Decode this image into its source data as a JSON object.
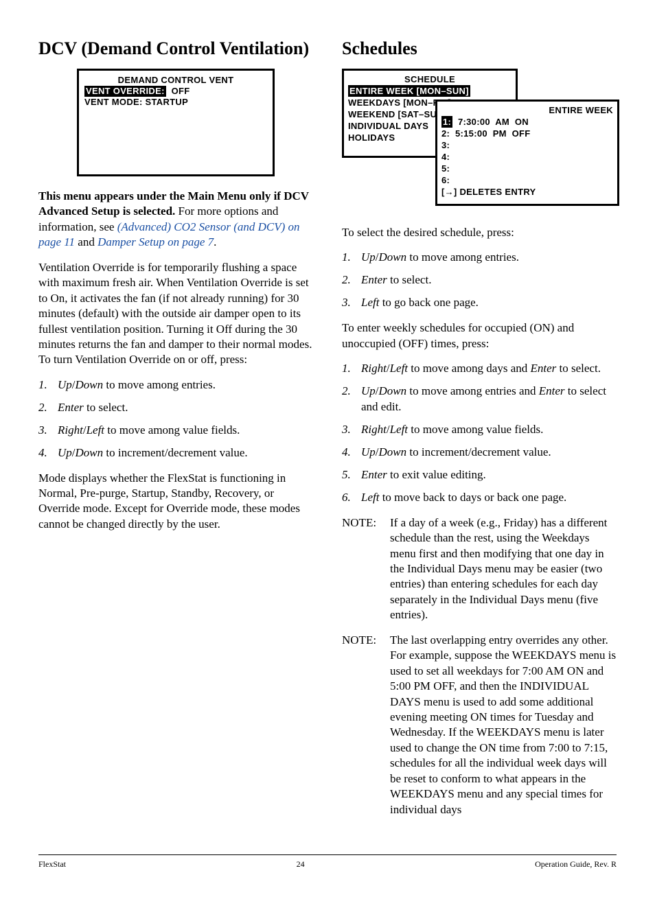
{
  "left": {
    "heading": "DCV (Demand Control Ventilation)",
    "lcd": {
      "title": "DEMAND CONTROL VENT",
      "line1_label": "VENT OVERRIDE:",
      "line1_value": "OFF",
      "line2": "VENT MODE: STARTUP"
    },
    "intro_bold": "This menu appears under the Main Menu only if DCV Advanced Setup is selected.",
    "intro_rest1": " For more options and information, see ",
    "intro_link1": "(Advanced) CO2 Sensor (and DCV) on page 11",
    "intro_rest2": " and ",
    "intro_link2": "Damper Setup on page 7",
    "intro_rest3": ".",
    "para2": "Ventilation Override is for temporarily flushing a space with maximum fresh air. When Ventilation Override is set to On, it activates the fan (if not already running) for 30 minutes (default) with the outside air damper open to its fullest ventilation position. Turning it Off during the 30 minutes returns the fan and damper to their normal modes. To turn Ventilation Override on or off, press:",
    "list1": [
      {
        "n": "1.",
        "it": "Up",
        "sep": "/",
        "it2": "Down",
        "rest": " to move among entries."
      },
      {
        "n": "2.",
        "it": "Enter",
        "rest": " to select."
      },
      {
        "n": "3.",
        "it": "Right",
        "sep": "/",
        "it2": "Left",
        "rest": " to move among value fields."
      },
      {
        "n": "4.",
        "it": "Up",
        "sep": "/",
        "it2": "Down",
        "rest": " to increment/decrement value."
      }
    ],
    "para3": "Mode displays whether the FlexStat is functioning in Normal, Pre-purge, Startup, Standby, Recovery, or Override mode. Except for Override mode, these modes cannot be changed directly by the user."
  },
  "right": {
    "heading": "Schedules",
    "lcd_back": {
      "title": "SCHEDULE",
      "line1": "ENTIRE WEEK [MON–SUN]",
      "line2": "WEEKDAYS [MON–FRI]",
      "line3": "WEEKEND [SAT–SUN]",
      "line4": "INDIVIDUAL DAYS",
      "line5": "HOLIDAYS"
    },
    "lcd_front": {
      "title": "ENTIRE WEEK",
      "rows": [
        {
          "n": "1:",
          "rest": "  7:30:00  AM  ON",
          "sel": true
        },
        {
          "n": "2:",
          "rest": "  5:15:00  PM  OFF"
        },
        {
          "n": "3:",
          "rest": ""
        },
        {
          "n": "4:",
          "rest": ""
        },
        {
          "n": "5:",
          "rest": ""
        },
        {
          "n": "6:",
          "rest": ""
        }
      ],
      "footer": "[→] DELETES ENTRY"
    },
    "para1": "To select the desired schedule, press:",
    "list1": [
      {
        "n": "1.",
        "it": "Up",
        "sep": "/",
        "it2": "Down",
        "rest": " to move among entries."
      },
      {
        "n": "2.",
        "it": "Enter",
        "rest": " to select."
      },
      {
        "n": "3.",
        "it": "Left",
        "rest": " to go back one page."
      }
    ],
    "para2": "To enter weekly schedules for occupied (ON) and unoccupied (OFF) times, press:",
    "list2": [
      {
        "n": "1.",
        "it": "Right",
        "sep": "/",
        "it2": "Left",
        "rest": " to move among days and ",
        "it3": "Enter",
        "rest2": " to select."
      },
      {
        "n": "2.",
        "it": "Up",
        "sep": "/",
        "it2": "Down",
        "rest": " to move among entries and ",
        "it3": "Enter",
        "rest2": " to select and edit."
      },
      {
        "n": "3.",
        "it": "Right",
        "sep": "/",
        "it2": "Left",
        "rest": " to move among value fields."
      },
      {
        "n": "4.",
        "it": "Up",
        "sep": "/",
        "it2": "Down",
        "rest": " to increment/decrement value."
      },
      {
        "n": "5.",
        "it": "Enter",
        "rest": " to exit value editing."
      },
      {
        "n": "6.",
        "it": "Left",
        "rest": " to move back to days or back one page."
      }
    ],
    "note1_label": "NOTE:",
    "note1_body": "If a day of a week (e.g., Friday) has a different schedule than the rest, using the Weekdays menu first and then modifying that one day in the Individual Days menu may be easier (two entries) than entering schedules for each day separately in the Individual Days menu (five entries).",
    "note2_label": "NOTE:",
    "note2_body": "The last overlapping entry overrides any other. For example, suppose the WEEKDAYS menu is used to set all weekdays for 7:00 AM ON and 5:00 PM OFF, and then the INDIVIDUAL DAYS menu is used to add some additional evening meeting ON times for Tuesday and Wednesday. If the WEEKDAYS menu is later used to change the ON time from 7:00 to 7:15, schedules for all the individual week days will be reset to conform to what appears in the WEEKDAYS menu and any special times for individual days"
  },
  "footer": {
    "left": "FlexStat",
    "center": "24",
    "right": "Operation Guide, Rev. R"
  }
}
